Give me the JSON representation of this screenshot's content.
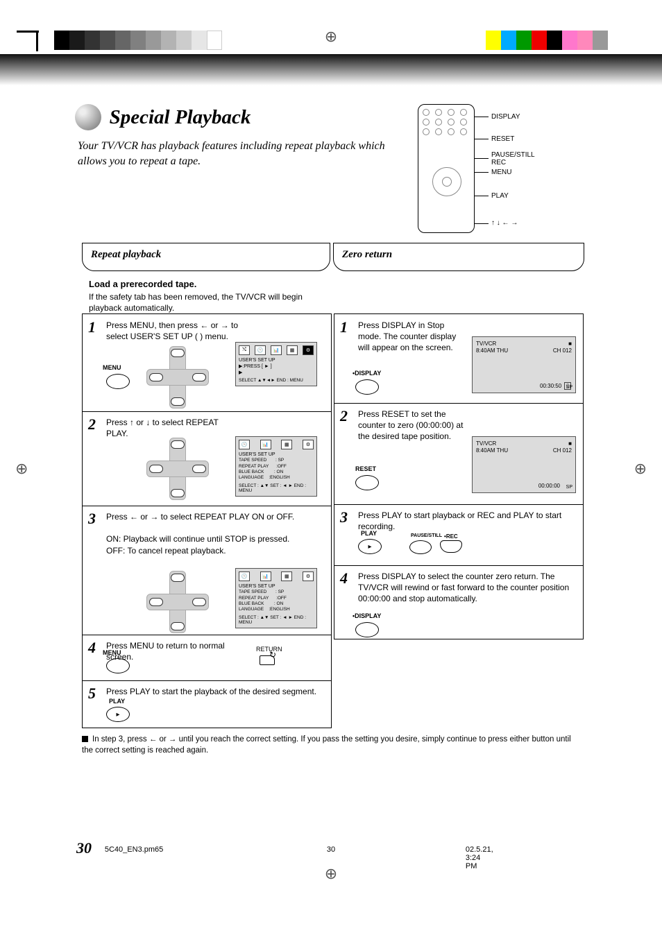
{
  "page": {
    "title": "Special Playback",
    "subtitle": "Your TV/VCR has playback features including repeat playback which allows you to repeat a tape.",
    "pagenum": "30",
    "footer_filename": "5C40_EN3.pm65",
    "footer_page": "30",
    "footer_date": "02.5.21, 3:24 PM"
  },
  "remote_labels": {
    "a": "DISPLAY",
    "b": "RESET",
    "c": "PAUSE/STILL\nREC",
    "d": "MENU",
    "e": "PLAY",
    "f": "↑ ↓ ← →"
  },
  "col_left_title": "Repeat playback",
  "col_right_title": "Zero return",
  "pretext_bold": "Load a prerecorded tape.",
  "pretext_note": "If the safety tab has been removed, the TV/VCR will begin playback automatically.",
  "left_steps": [
    {
      "n": "1",
      "text": "Press MENU, then press ← or → to select USER'S SET UP (      ) menu."
    },
    {
      "n": "2",
      "text": "Press ↑ or ↓ to select REPEAT PLAY."
    },
    {
      "n": "3",
      "text": "Press ← or → to select REPEAT PLAY ON or OFF.\n\nON: Playback will continue until STOP is pressed.\nOFF: To cancel repeat playback."
    },
    {
      "n": "4",
      "text": "Press MENU to return to normal screen."
    },
    {
      "n": "5",
      "text": "Press PLAY to start the playback of the desired segment."
    }
  ],
  "right_steps": [
    {
      "n": "1",
      "text": "Press DISPLAY in Stop mode. The counter display will appear on the screen."
    },
    {
      "n": "2",
      "text": "Press RESET to set the counter to zero (00:00:00) at the desired tape position."
    },
    {
      "n": "3",
      "text": "Press PLAY to start playback or REC and PLAY to start recording."
    },
    {
      "n": "4",
      "text": "Press DISPLAY to select the counter zero return. The TV/VCR will rewind or fast forward to the counter position 00:00:00 and stop automatically."
    }
  ],
  "lcd1": {
    "line1": "TV/VCR",
    "line2": "8:40AM  THU",
    "ch": "CH 012",
    "counter": "00:30:50",
    "sp": "SP",
    "stop": "■"
  },
  "lcd2": {
    "line1": "TV/VCR",
    "line2": "8:40AM  THU",
    "ch": "CH 012",
    "counter": "00:00:00",
    "sp": "SP",
    "stop": "■"
  },
  "osd": {
    "setup_label": "USER'S SET UP",
    "menu_items": "TAPE SPEED       : SP\nREPEAT PLAY      :OFF\nBLUE BACK        : ON\nLANGUAGE    :ENGLISH",
    "select_set": "SELECT : ▲▼  SET : ◄ ►  END : MENU",
    "select_end": "SELECT  ▲▼◄►     END : MENU",
    "tip": "▶:PRESS [ ► ]\n▶"
  },
  "bottom_label_return": "RETURN",
  "button_labels": {
    "menu": "MENU",
    "display": "DISPLAY",
    "reset": "RESET",
    "play": "PLAY",
    "rec": "REC",
    "pause": "PAUSE/STILL"
  },
  "note": "In step 3, press ← or → until you reach the correct setting. If you pass the setting you desire, simply continue to press either button until the correct setting is reached again."
}
